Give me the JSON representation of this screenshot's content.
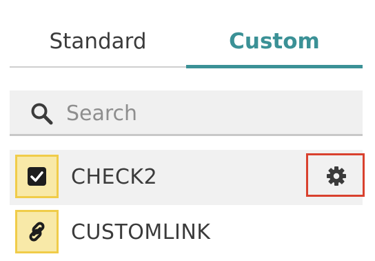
{
  "tabs": [
    {
      "label": "Standard",
      "active": false
    },
    {
      "label": "Custom",
      "active": true
    }
  ],
  "search": {
    "placeholder": "Search",
    "value": ""
  },
  "items": [
    {
      "label": "CHECK2",
      "icon": "checkbox-icon",
      "selected": true
    },
    {
      "label": "CUSTOMLINK",
      "icon": "link-icon",
      "selected": false
    }
  ],
  "colors": {
    "accent": "#3b9196",
    "icon_border": "#f0cc49",
    "icon_fill": "#f8e9a8",
    "highlight": "#d9412e"
  }
}
